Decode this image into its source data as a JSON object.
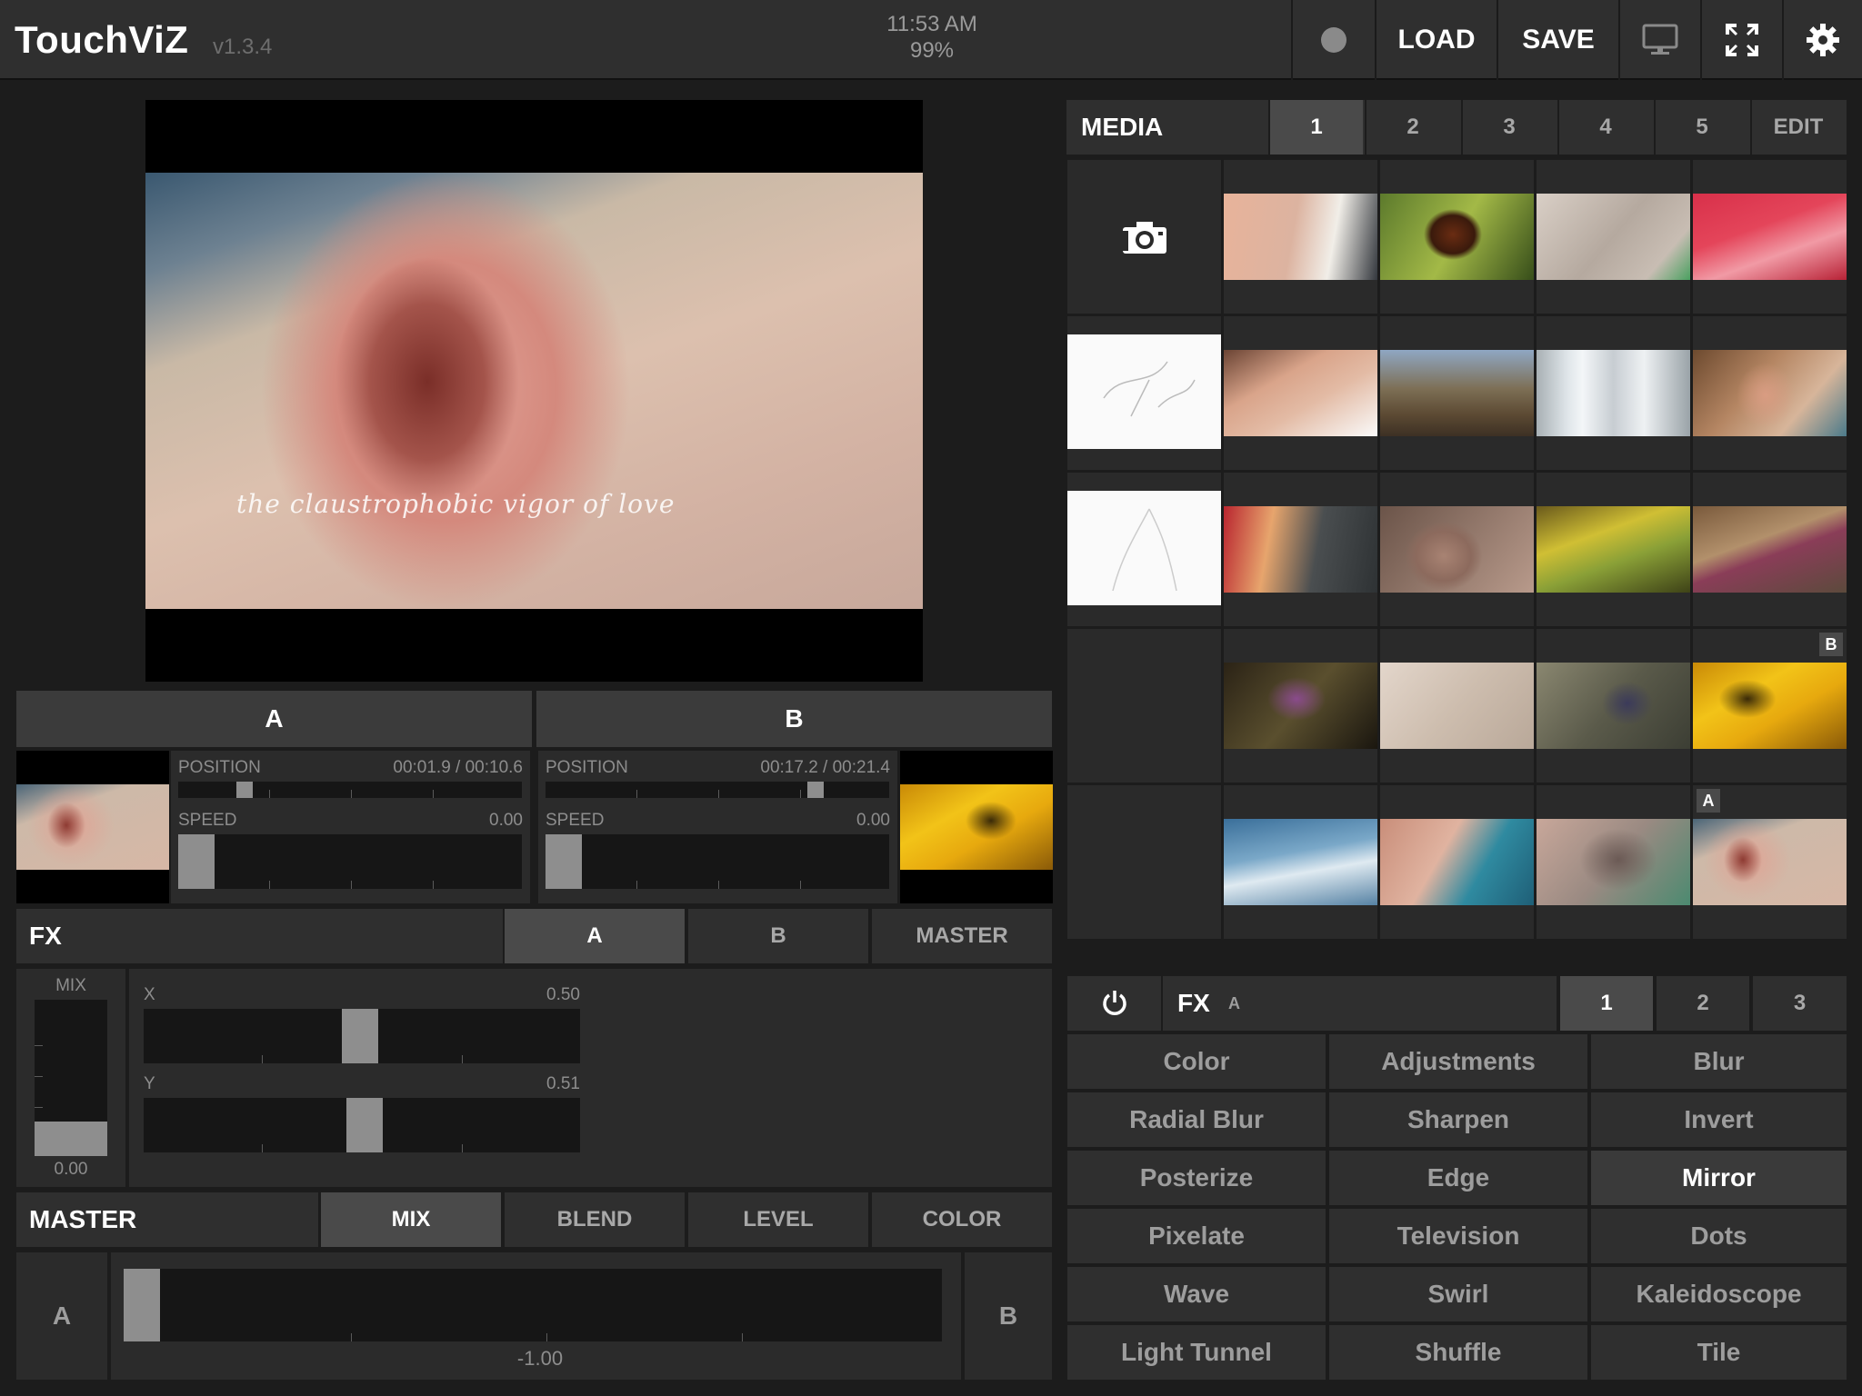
{
  "app": {
    "title": "TouchViZ",
    "version": "v1.3.4"
  },
  "status": {
    "time": "11:53 AM",
    "battery": "99%"
  },
  "toolbar": {
    "load_label": "LOAD",
    "save_label": "SAVE",
    "icons": [
      "record-dot",
      "monitor-icon",
      "fullscreen-icon",
      "gear-icon"
    ]
  },
  "preview": {
    "caption": "the claustrophobic vigor of love"
  },
  "decks": {
    "a": {
      "label": "A",
      "position_label": "POSITION",
      "position_value": "00:01.9 / 00:10.6",
      "position_fraction": 0.18,
      "speed_label": "SPEED",
      "speed_value": "0.00"
    },
    "b": {
      "label": "B",
      "position_label": "POSITION",
      "position_value": "00:17.2 / 00:21.4",
      "position_fraction": 0.8,
      "speed_label": "SPEED",
      "speed_value": "0.00"
    }
  },
  "fx_left": {
    "title": "FX",
    "tabs": [
      "A",
      "B",
      "MASTER"
    ],
    "active_tab": "A",
    "mix_label": "MIX",
    "mix_value": "0.00",
    "x_label": "X",
    "x_value": "0.50",
    "y_label": "Y",
    "y_value": "0.51"
  },
  "master": {
    "title": "MASTER",
    "tabs": [
      "MIX",
      "BLEND",
      "LEVEL",
      "COLOR"
    ],
    "active_tab": "MIX",
    "left_label": "A",
    "right_label": "B",
    "value": "-1.00"
  },
  "media": {
    "title": "MEDIA",
    "tabs": [
      "1",
      "2",
      "3",
      "4",
      "5"
    ],
    "active_tab": "1",
    "edit_label": "EDIT",
    "badges": {
      "b": "B",
      "a": "A"
    }
  },
  "fx_right": {
    "title": "FX",
    "target": "A",
    "tabs": [
      "1",
      "2",
      "3"
    ],
    "active_tab": "1",
    "effects": [
      "Color",
      "Adjustments",
      "Blur",
      "Radial Blur",
      "Sharpen",
      "Invert",
      "Posterize",
      "Edge",
      "Mirror",
      "Pixelate",
      "Television",
      "Dots",
      "Wave",
      "Swirl",
      "Kaleidoscope",
      "Light Tunnel",
      "Shuffle",
      "Tile"
    ],
    "active_effect": "Mirror"
  },
  "colors": {
    "background": "#1c1c1c",
    "panel": "#2f2f2f",
    "active": "#4a4a4a",
    "knob": "#8e8e8e"
  }
}
